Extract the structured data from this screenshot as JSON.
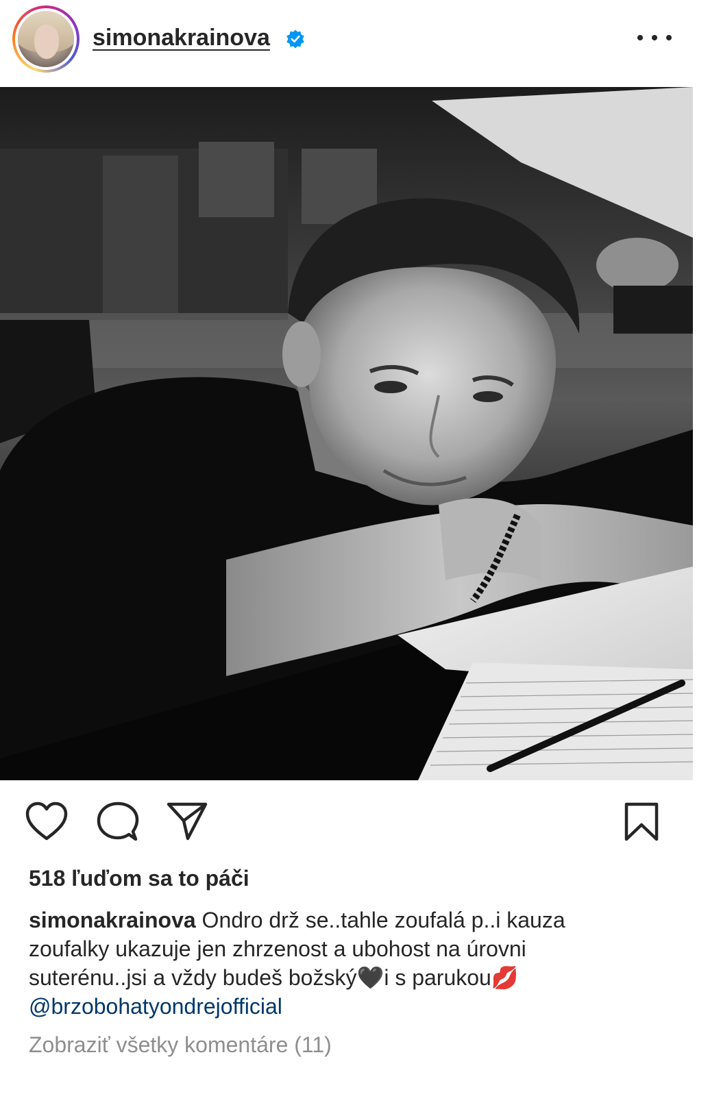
{
  "header": {
    "username": "simonakrainova",
    "verified_icon": "verified-badge-icon",
    "more_icon": "more-options-icon"
  },
  "post": {
    "image_description_icon": "post-photo",
    "actions": {
      "like_icon": "heart-icon",
      "comment_icon": "comment-icon",
      "share_icon": "share-icon",
      "save_icon": "bookmark-icon"
    },
    "likes_text": "518 ľuďom sa to páči",
    "caption": {
      "username": "simonakrainova",
      "text_line1": " Ondro drž se..tahle zoufalá p..i kauza",
      "text_line2": "zoufalky ukazuje jen zhrzenost a ubohost na úrovni",
      "text_line3a": "suterénu..jsi a vždy budeš božský",
      "emoji_heart": "🖤",
      "text_line3b": "i s parukou",
      "emoji_kiss": "💋",
      "mention": "@brzobohatyondrejofficial"
    },
    "view_comments": "Zobraziť všetky komentáre (11)"
  },
  "colors": {
    "text": "#262626",
    "muted": "#8e8e8e",
    "mention": "#00376b",
    "verified": "#0095f6"
  }
}
